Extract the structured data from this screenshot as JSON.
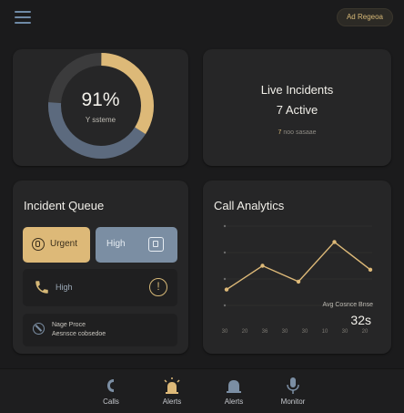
{
  "header": {
    "region_label": "Ad Regeoa"
  },
  "summary": {
    "percent": "91%",
    "caption": "Y ssteme"
  },
  "live": {
    "title": "Live Incidents",
    "count": "7 Active",
    "sub_prefix": "7",
    "sub_text": "noo sasaae"
  },
  "queue": {
    "title": "Incident Queue",
    "urgent_label": "Urgent",
    "high_label": "High",
    "row_high_label": "High",
    "info_glyph": "!",
    "page_line1": "Nage Proce",
    "page_line2": "Aesnsce cobsedoe"
  },
  "analytics": {
    "title": "Call Analytics",
    "stat_label": "Avg Cosnce Bnse",
    "stat_value": "32s"
  },
  "nav": {
    "items": [
      {
        "label": "Calls",
        "icon": "phone-icon"
      },
      {
        "label": "Alerts",
        "icon": "siren-icon"
      },
      {
        "label": "Alerts",
        "icon": "bell-icon"
      },
      {
        "label": "Monitor",
        "icon": "microphone-icon"
      }
    ]
  },
  "colors": {
    "accent_gold": "#ddb978",
    "accent_slate": "#7b8ea3",
    "card": "#262627",
    "background": "#1b1b1c"
  },
  "chart_data": {
    "type": "line",
    "title": "Call Analytics",
    "x": [
      "30",
      "20",
      "36",
      "30",
      "30",
      "10",
      "30",
      "20"
    ],
    "series": [
      {
        "values": [
          2,
          5,
          3,
          8,
          4.5
        ]
      }
    ],
    "value_scale": [
      0,
      10
    ],
    "grid": true
  }
}
